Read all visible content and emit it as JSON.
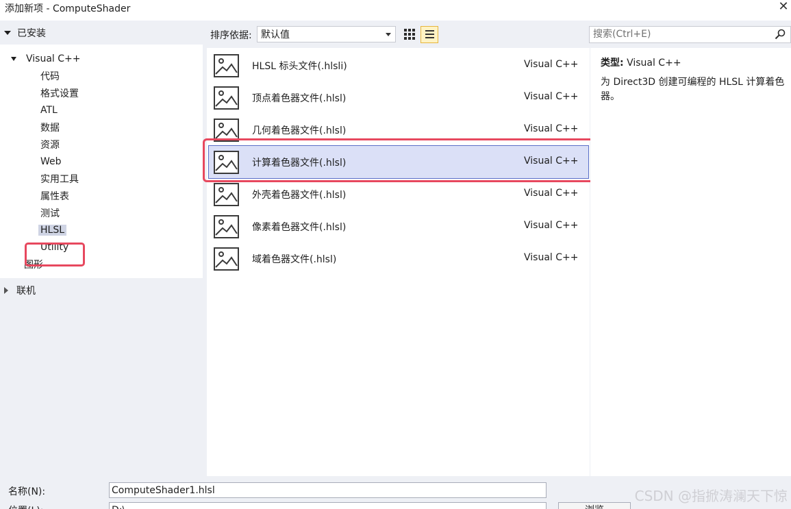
{
  "window": {
    "title": "添加新项 - ComputeShader"
  },
  "left": {
    "installed": "已安装",
    "tree": [
      {
        "label": "Visual C++",
        "level": 0,
        "expanded": true
      },
      {
        "label": "代码",
        "level": 1
      },
      {
        "label": "格式设置",
        "level": 1
      },
      {
        "label": "ATL",
        "level": 1
      },
      {
        "label": "数据",
        "level": 1
      },
      {
        "label": "资源",
        "level": 1
      },
      {
        "label": "Web",
        "level": 1
      },
      {
        "label": "实用工具",
        "level": 1
      },
      {
        "label": "属性表",
        "level": 1
      },
      {
        "label": "测试",
        "level": 1
      },
      {
        "label": "HLSL",
        "level": 1,
        "selected": true
      },
      {
        "label": "Utility",
        "level": 1
      },
      {
        "label": "图形",
        "level": 0
      }
    ],
    "online": "联机"
  },
  "toolbar": {
    "sort_label": "排序依据:",
    "sort_value": "默认值"
  },
  "search": {
    "placeholder": "搜索(Ctrl+E)"
  },
  "items": [
    {
      "name": "HLSL 标头文件(.hlsli)",
      "lang": "Visual C++"
    },
    {
      "name": "顶点着色器文件(.hlsl)",
      "lang": "Visual C++"
    },
    {
      "name": "几何着色器文件(.hlsl)",
      "lang": "Visual C++"
    },
    {
      "name": "计算着色器文件(.hlsl)",
      "lang": "Visual C++",
      "selected": true
    },
    {
      "name": "外壳着色器文件(.hlsl)",
      "lang": "Visual C++"
    },
    {
      "name": "像素着色器文件(.hlsl)",
      "lang": "Visual C++"
    },
    {
      "name": "域着色器文件(.hlsl)",
      "lang": "Visual C++"
    }
  ],
  "info": {
    "type_label": "类型:",
    "type_value": "Visual C++",
    "description": "为 Direct3D 创建可编程的 HLSL 计算着色器。"
  },
  "bottom": {
    "name_label": "名称(N):",
    "name_value": "ComputeShader1.hlsl",
    "location_label": "位置(L):",
    "location_value": "D:\\",
    "browse_label": "浏览"
  },
  "watermark": "CSDN @指掀涛澜天下惊",
  "colors": {
    "selection_bg": "#dbe0f7",
    "highlight_border": "#e7485e",
    "pane_bg": "#eef0f5"
  }
}
